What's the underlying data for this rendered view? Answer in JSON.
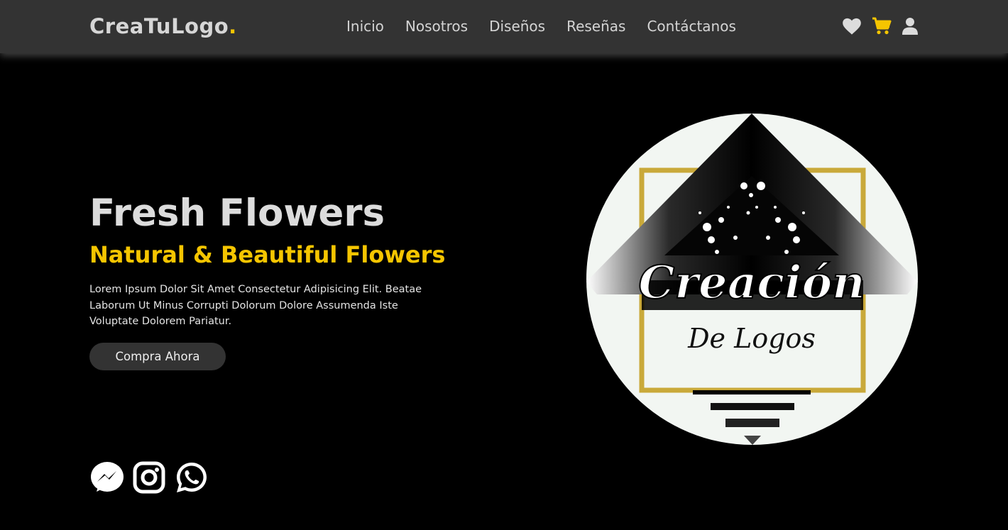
{
  "header": {
    "brand": "CreaTuLogo",
    "brand_dot": ".",
    "nav": [
      "Inicio",
      "Nosotros",
      "Diseños",
      "Reseñas",
      "Contáctanos"
    ],
    "icons": [
      "heart-icon",
      "cart-icon",
      "user-icon"
    ]
  },
  "hero": {
    "title": "Fresh Flowers",
    "subtitle": "Natural & Beautiful Flowers",
    "description": "Lorem Ipsum Dolor Sit Amet Consectetur Adipisicing Elit. Beatae Laborum Ut Minus Corrupti Dolorum Dolore Assumenda Iste Voluptate Dolorem Pariatur.",
    "cta": "Compra Ahora"
  },
  "logo_image": {
    "script_text": "Creación",
    "subtitle_text": "De Logos"
  },
  "social": [
    "messenger-icon",
    "instagram-icon",
    "whatsapp-icon"
  ],
  "colors": {
    "accent": "#f5c500",
    "header_bg": "#333333",
    "page_bg": "#000000",
    "gold_frame": "#c9a93a"
  }
}
